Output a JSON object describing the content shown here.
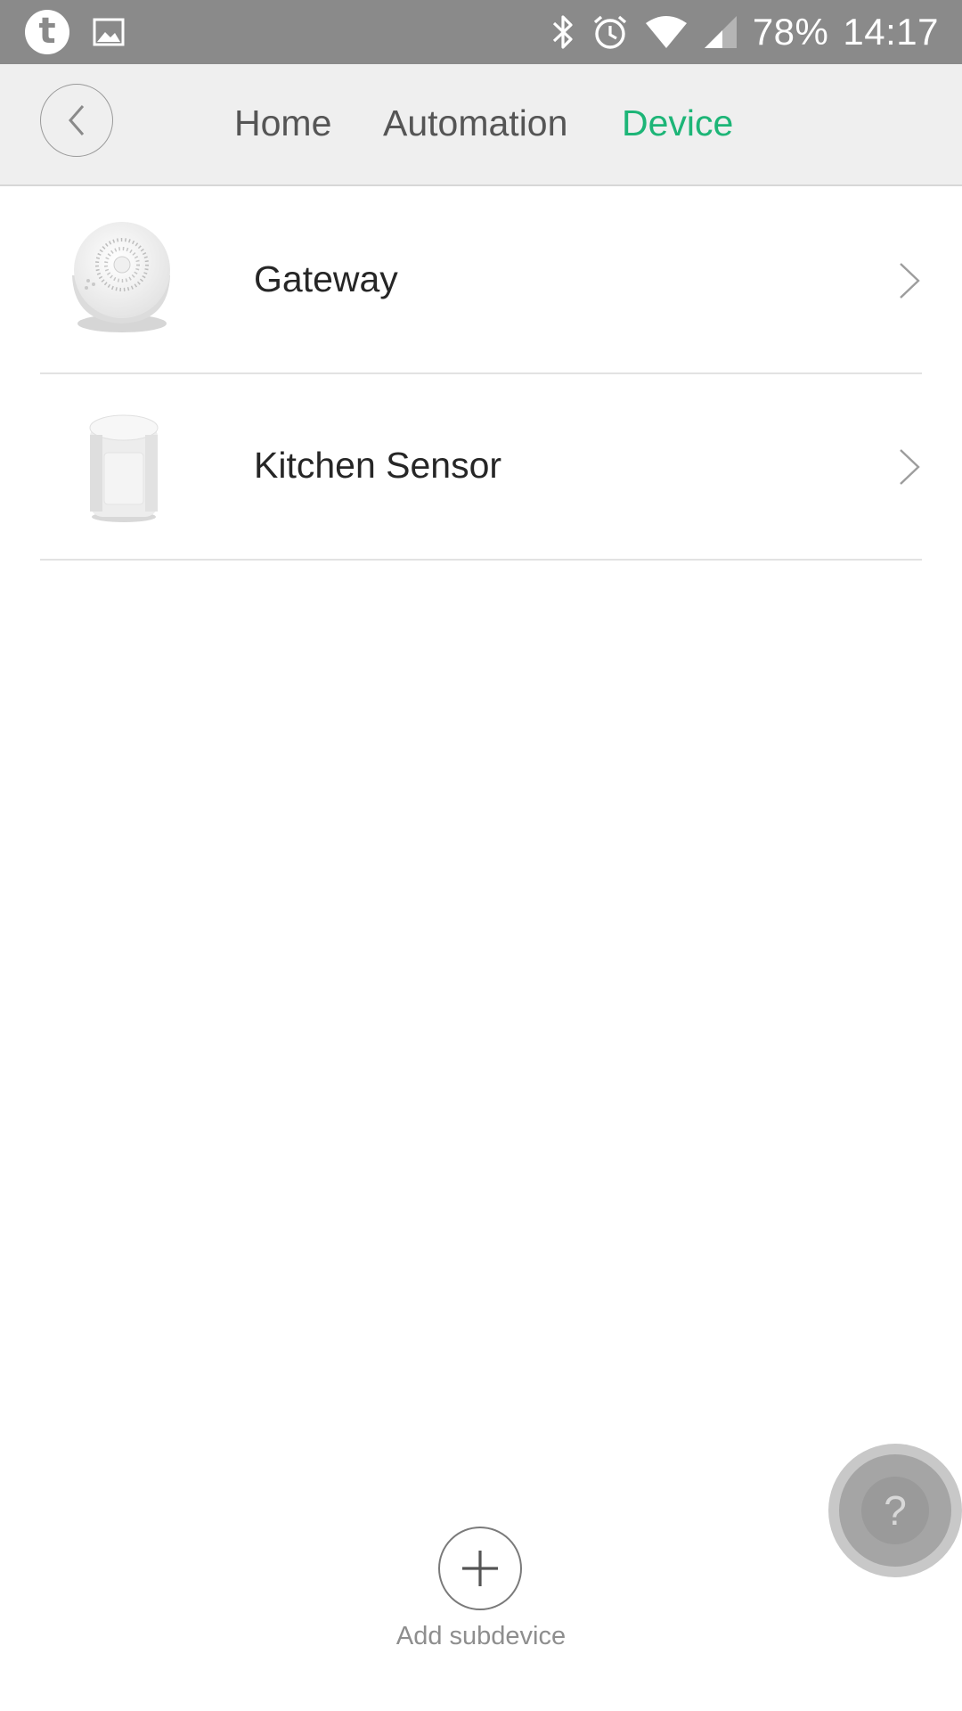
{
  "status_bar": {
    "icons_left": [
      "tumblr-icon",
      "image-icon"
    ],
    "icons_right": [
      "bluetooth-icon",
      "alarm-icon",
      "wifi-icon",
      "signal-icon"
    ],
    "battery": "78%",
    "time": "14:17",
    "tumblr_glyph": "t"
  },
  "header": {
    "tabs": [
      {
        "label": "Home",
        "active": false
      },
      {
        "label": "Automation",
        "active": false
      },
      {
        "label": "Device",
        "active": true
      }
    ],
    "accent_color": "#1db577"
  },
  "devices": [
    {
      "name": "Gateway",
      "icon": "gateway-device-image"
    },
    {
      "name": "Kitchen Sensor",
      "icon": "motion-sensor-device-image"
    }
  ],
  "add_subdevice": {
    "label": "Add subdevice"
  },
  "help": {
    "glyph": "?"
  }
}
